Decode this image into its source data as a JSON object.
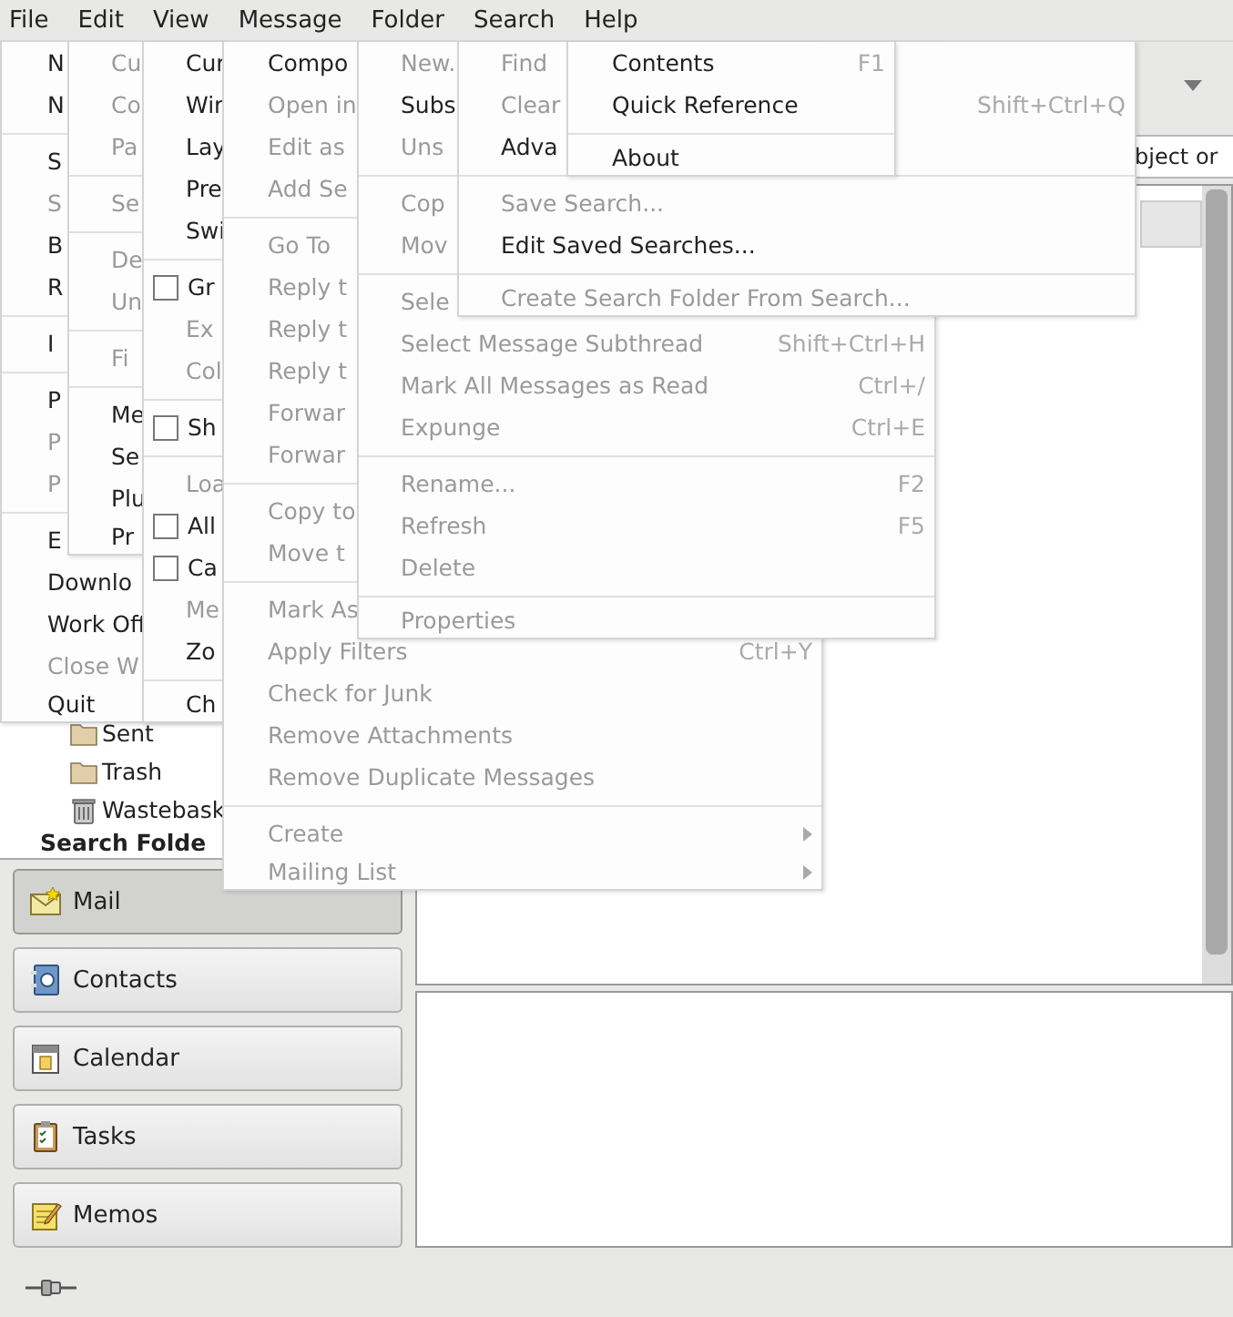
{
  "menubar": [
    "File",
    "Edit",
    "View",
    "Message",
    "Folder",
    "Search",
    "Help"
  ],
  "menus": [
    {
      "items": [
        {
          "kind": "item",
          "label": "N",
          "disabled": false
        },
        {
          "kind": "item",
          "label": "N",
          "disabled": false
        },
        {
          "kind": "separator"
        },
        {
          "kind": "item",
          "label": "S",
          "disabled": false
        },
        {
          "kind": "item",
          "label": "S",
          "disabled": true
        },
        {
          "kind": "item",
          "label": "B",
          "disabled": false
        },
        {
          "kind": "item",
          "label": "R",
          "disabled": false
        },
        {
          "kind": "separator"
        },
        {
          "kind": "item",
          "label": "I",
          "disabled": false
        },
        {
          "kind": "separator"
        },
        {
          "kind": "item",
          "label": "P",
          "disabled": false
        },
        {
          "kind": "item",
          "label": "P",
          "disabled": true
        },
        {
          "kind": "item",
          "label": "P",
          "disabled": true
        },
        {
          "kind": "separator"
        },
        {
          "kind": "item",
          "label": "E",
          "disabled": false
        },
        {
          "kind": "item",
          "label": "Downlo",
          "disabled": false
        },
        {
          "kind": "item",
          "label": "Work Off",
          "disabled": false
        },
        {
          "kind": "item",
          "label": "Close W",
          "disabled": true
        },
        {
          "kind": "item",
          "label": "Quit",
          "disabled": false
        }
      ]
    },
    {
      "items": [
        {
          "kind": "item",
          "label": "Cu",
          "disabled": true
        },
        {
          "kind": "item",
          "label": "Co",
          "disabled": true
        },
        {
          "kind": "item",
          "label": "Pa",
          "disabled": true
        },
        {
          "kind": "separator"
        },
        {
          "kind": "item",
          "label": "Se",
          "disabled": true
        },
        {
          "kind": "separator"
        },
        {
          "kind": "item",
          "label": "De",
          "disabled": true
        },
        {
          "kind": "item",
          "label": "Un",
          "disabled": true
        },
        {
          "kind": "separator"
        },
        {
          "kind": "item",
          "label": "Fi",
          "disabled": true
        },
        {
          "kind": "separator"
        },
        {
          "kind": "item",
          "label": "Me",
          "disabled": false
        },
        {
          "kind": "item",
          "label": "Se",
          "disabled": false
        },
        {
          "kind": "item",
          "label": "Plu",
          "disabled": false
        },
        {
          "kind": "item",
          "label": "Pr",
          "disabled": false
        }
      ]
    },
    {
      "items": [
        {
          "kind": "item",
          "label": "Cur",
          "disabled": false
        },
        {
          "kind": "item",
          "label": "Wir",
          "disabled": false
        },
        {
          "kind": "item",
          "label": "Lay",
          "disabled": false
        },
        {
          "kind": "item",
          "label": "Pre",
          "disabled": false
        },
        {
          "kind": "item",
          "label": "Swi",
          "disabled": false
        },
        {
          "kind": "separator"
        },
        {
          "kind": "check",
          "label": "Gr",
          "disabled": false,
          "checked": false
        },
        {
          "kind": "item",
          "label": "Ex",
          "disabled": true
        },
        {
          "kind": "item",
          "label": "Col",
          "disabled": true
        },
        {
          "kind": "separator"
        },
        {
          "kind": "check",
          "label": "Sh",
          "disabled": false,
          "checked": false
        },
        {
          "kind": "separator"
        },
        {
          "kind": "item",
          "label": "Loa",
          "disabled": true
        },
        {
          "kind": "check",
          "label": "All",
          "disabled": false,
          "checked": false
        },
        {
          "kind": "check",
          "label": "Ca",
          "disabled": false,
          "checked": false
        },
        {
          "kind": "item",
          "label": "Me",
          "disabled": true
        },
        {
          "kind": "item",
          "label": "Zo",
          "disabled": false
        },
        {
          "kind": "separator"
        },
        {
          "kind": "item",
          "label": "Ch",
          "disabled": false
        }
      ]
    },
    {
      "items": [
        {
          "kind": "item",
          "label": "Compo",
          "disabled": false
        },
        {
          "kind": "item",
          "label": "Open in",
          "disabled": true
        },
        {
          "kind": "item",
          "label": "Edit as",
          "disabled": true
        },
        {
          "kind": "item",
          "label": "Add Se",
          "disabled": true
        },
        {
          "kind": "separator"
        },
        {
          "kind": "item",
          "label": "Go To",
          "disabled": true
        },
        {
          "kind": "item",
          "label": "Reply t",
          "disabled": true
        },
        {
          "kind": "item",
          "label": "Reply t",
          "disabled": true
        },
        {
          "kind": "item",
          "label": "Reply t",
          "disabled": true
        },
        {
          "kind": "item",
          "label": "Forwar",
          "disabled": true
        },
        {
          "kind": "item",
          "label": "Forwar",
          "disabled": true
        },
        {
          "kind": "separator"
        },
        {
          "kind": "item",
          "label": "Copy to",
          "disabled": true
        },
        {
          "kind": "item",
          "label": "Move t",
          "disabled": true
        },
        {
          "kind": "separator"
        },
        {
          "kind": "item",
          "label": "Mark As",
          "disabled": true
        },
        {
          "kind": "item",
          "label": "Apply Filters",
          "disabled": true,
          "shortcut": "Ctrl+Y"
        },
        {
          "kind": "item",
          "label": "Check for Junk",
          "disabled": true
        },
        {
          "kind": "item",
          "label": "Remove Attachments",
          "disabled": true
        },
        {
          "kind": "item",
          "label": "Remove Duplicate Messages",
          "disabled": true
        },
        {
          "kind": "separator"
        },
        {
          "kind": "submenu",
          "label": "Create",
          "disabled": true
        },
        {
          "kind": "submenu",
          "label": "Mailing List",
          "disabled": true
        }
      ]
    },
    {
      "items": [
        {
          "kind": "item",
          "label": "New.",
          "disabled": true
        },
        {
          "kind": "item",
          "label": "Subs",
          "disabled": false
        },
        {
          "kind": "item",
          "label": "Uns",
          "disabled": true
        },
        {
          "kind": "separator"
        },
        {
          "kind": "item",
          "label": "Cop",
          "disabled": true
        },
        {
          "kind": "item",
          "label": "Mov",
          "disabled": true
        },
        {
          "kind": "separator"
        },
        {
          "kind": "item",
          "label": "Sele",
          "disabled": true
        },
        {
          "kind": "item",
          "label": "Select Message Subthread",
          "disabled": true,
          "shortcut": "Shift+Ctrl+H"
        },
        {
          "kind": "item",
          "label": "Mark All Messages as Read",
          "disabled": true,
          "shortcut": "Ctrl+/"
        },
        {
          "kind": "item",
          "label": "Expunge",
          "disabled": true,
          "shortcut": "Ctrl+E"
        },
        {
          "kind": "separator"
        },
        {
          "kind": "item",
          "label": "Rename...",
          "disabled": true,
          "shortcut": "F2"
        },
        {
          "kind": "item",
          "label": "Refresh",
          "disabled": true,
          "shortcut": "F5"
        },
        {
          "kind": "item",
          "label": "Delete",
          "disabled": true
        },
        {
          "kind": "separator"
        },
        {
          "kind": "item",
          "label": "Properties",
          "disabled": true
        }
      ]
    },
    {
      "items": [
        {
          "kind": "item",
          "label": "Find",
          "disabled": true
        },
        {
          "kind": "item",
          "label": "Clear",
          "disabled": true,
          "shortcut": "Shift+Ctrl+Q"
        },
        {
          "kind": "item",
          "label": "Adva",
          "disabled": false
        },
        {
          "kind": "separator"
        },
        {
          "kind": "item",
          "label": "Save Search...",
          "disabled": true
        },
        {
          "kind": "item",
          "label": "Edit Saved Searches...",
          "disabled": false
        },
        {
          "kind": "separator"
        },
        {
          "kind": "item",
          "label": "Create Search Folder From Search...",
          "disabled": true
        }
      ]
    },
    {
      "items": [
        {
          "kind": "item",
          "label": "Contents",
          "disabled": false,
          "shortcut": "F1"
        },
        {
          "kind": "item",
          "label": "Quick Reference",
          "disabled": false
        },
        {
          "kind": "separator"
        },
        {
          "kind": "item",
          "label": "About",
          "disabled": false
        }
      ]
    }
  ],
  "search": {
    "value": "bject or"
  },
  "folders": [
    {
      "label": "Sent",
      "kind": "folder"
    },
    {
      "label": "Trash",
      "kind": "folder"
    },
    {
      "label": "Wastebask",
      "kind": "trash"
    }
  ],
  "search_folders": {
    "label": "Search Folde"
  },
  "switcher": [
    {
      "label": "Mail",
      "kind": "mail",
      "selected": true
    },
    {
      "label": "Contacts",
      "kind": "contacts",
      "selected": false
    },
    {
      "label": "Calendar",
      "kind": "calendar",
      "selected": false
    },
    {
      "label": "Tasks",
      "kind": "tasks",
      "selected": false
    },
    {
      "label": "Memos",
      "kind": "memos",
      "selected": false
    }
  ]
}
